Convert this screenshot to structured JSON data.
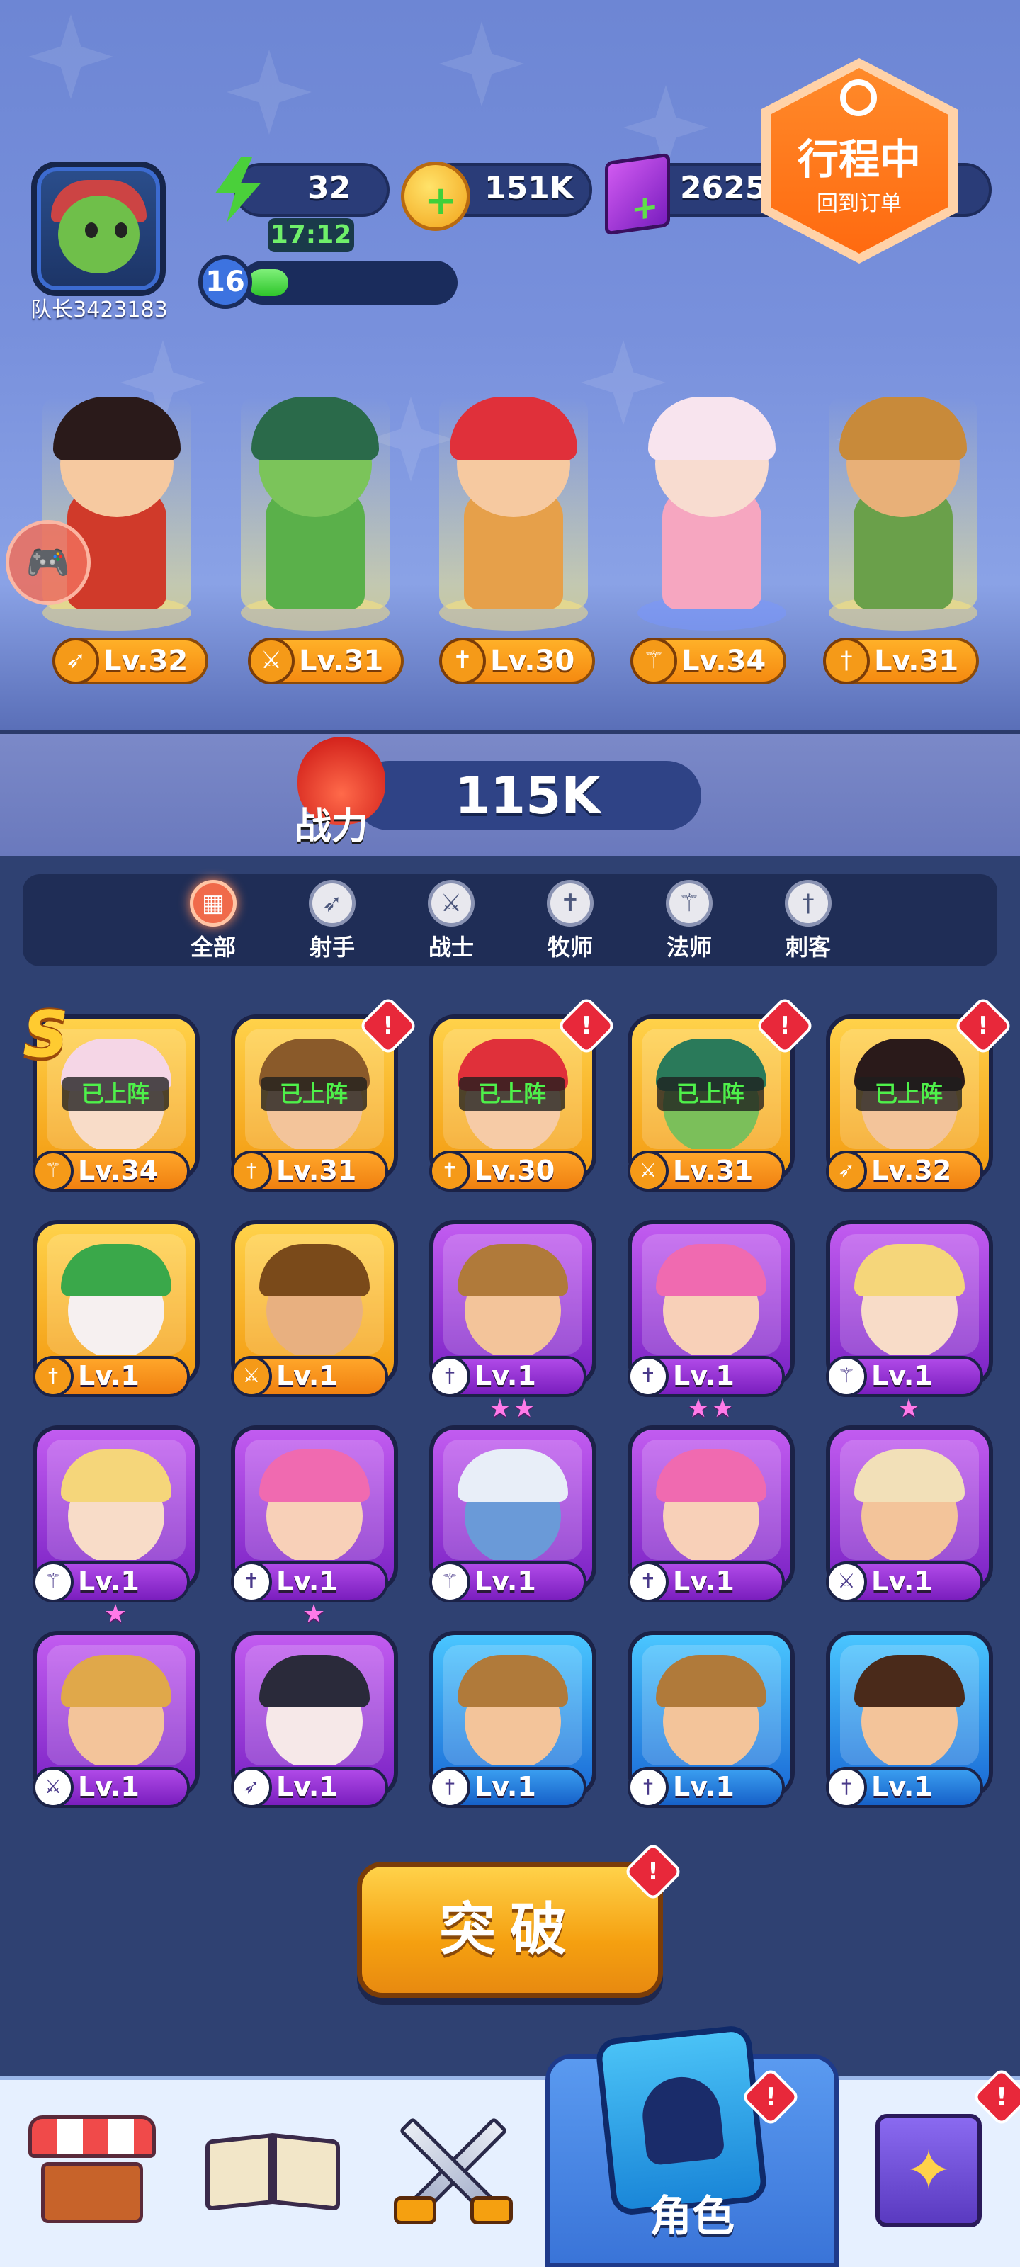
{
  "player": {
    "name": "队长3423183",
    "level": "16",
    "xp_fraction": 0.2
  },
  "resources": {
    "energy": "32",
    "energy_timer": "17:12",
    "gold": "151K",
    "gems": "2625"
  },
  "trip_badge": {
    "title": "行程中",
    "subtitle": "回到订单"
  },
  "lineup": [
    {
      "class_icon": "bow-icon",
      "level": "Lv.32"
    },
    {
      "class_icon": "sword-icon",
      "level": "Lv.31"
    },
    {
      "class_icon": "cross-icon",
      "level": "Lv.30"
    },
    {
      "class_icon": "staff-icon",
      "level": "Lv.34"
    },
    {
      "class_icon": "dagger-icon",
      "level": "Lv.31"
    }
  ],
  "power": {
    "label": "战力",
    "value": "115K"
  },
  "tabs": [
    {
      "label": "全部",
      "active": true
    },
    {
      "label": "射手"
    },
    {
      "label": "战士"
    },
    {
      "label": "牧师"
    },
    {
      "label": "法师"
    },
    {
      "label": "刺客"
    }
  ],
  "deployed_label": "已上阵",
  "rank_badge": "S",
  "heroes": [
    {
      "level": "Lv.34",
      "rarity": "gold",
      "deployed": true,
      "alert": false,
      "stars": 0,
      "class_icon": "staff-icon",
      "hair": "#f5d6e6",
      "skin": "#f8dcc8"
    },
    {
      "level": "Lv.31",
      "rarity": "gold",
      "deployed": true,
      "alert": true,
      "stars": 0,
      "class_icon": "dagger-icon",
      "hair": "#8a5a2a",
      "skin": "#f3c49a"
    },
    {
      "level": "Lv.30",
      "rarity": "gold",
      "deployed": true,
      "alert": true,
      "stars": 0,
      "class_icon": "cross-icon",
      "hair": "#e0303a",
      "skin": "#f6cba6"
    },
    {
      "level": "Lv.31",
      "rarity": "gold",
      "deployed": true,
      "alert": true,
      "stars": 0,
      "class_icon": "sword-icon",
      "hair": "#2a7a5a",
      "skin": "#7bbf5a"
    },
    {
      "level": "Lv.32",
      "rarity": "gold",
      "deployed": true,
      "alert": true,
      "stars": 0,
      "class_icon": "bow-icon",
      "hair": "#2a1a1a",
      "skin": "#f3c49a"
    },
    {
      "level": "Lv.1",
      "rarity": "gold",
      "deployed": false,
      "alert": false,
      "stars": 0,
      "class_icon": "dagger-icon",
      "hair": "#3aa84a",
      "skin": "#f6f0f0"
    },
    {
      "level": "Lv.1",
      "rarity": "gold",
      "deployed": false,
      "alert": false,
      "stars": 0,
      "class_icon": "sword-icon",
      "hair": "#7a4a1a",
      "skin": "#e8b080"
    },
    {
      "level": "Lv.1",
      "rarity": "purple",
      "deployed": false,
      "alert": false,
      "stars": 2,
      "class_icon": "dagger-icon",
      "hair": "#b07a3a",
      "skin": "#f3c49a"
    },
    {
      "level": "Lv.1",
      "rarity": "purple",
      "deployed": false,
      "alert": false,
      "stars": 2,
      "class_icon": "cross-icon",
      "hair": "#f06ab0",
      "skin": "#f8d0b8"
    },
    {
      "level": "Lv.1",
      "rarity": "purple",
      "deployed": false,
      "alert": false,
      "stars": 1,
      "class_icon": "staff-icon",
      "hair": "#f5d67a",
      "skin": "#f8dcc8"
    },
    {
      "level": "Lv.1",
      "rarity": "purple",
      "deployed": false,
      "alert": false,
      "stars": 1,
      "class_icon": "staff-icon",
      "hair": "#f5d67a",
      "skin": "#f8dcc8"
    },
    {
      "level": "Lv.1",
      "rarity": "purple",
      "deployed": false,
      "alert": false,
      "stars": 1,
      "class_icon": "cross-icon",
      "hair": "#f06ab0",
      "skin": "#f8d0b8"
    },
    {
      "level": "Lv.1",
      "rarity": "purple",
      "deployed": false,
      "alert": false,
      "stars": 0,
      "class_icon": "staff-icon",
      "hair": "#e8eef8",
      "skin": "#6a9ad8"
    },
    {
      "level": "Lv.1",
      "rarity": "purple",
      "deployed": false,
      "alert": false,
      "stars": 0,
      "class_icon": "cross-icon",
      "hair": "#f06ab0",
      "skin": "#f8d0b8"
    },
    {
      "level": "Lv.1",
      "rarity": "purple",
      "deployed": false,
      "alert": false,
      "stars": 0,
      "class_icon": "sword-icon",
      "hair": "#f2e0b8",
      "skin": "#f3c49a"
    },
    {
      "level": "Lv.1",
      "rarity": "purple",
      "deployed": false,
      "alert": false,
      "stars": 0,
      "class_icon": "sword-icon",
      "hair": "#e0a84a",
      "skin": "#f3c49a"
    },
    {
      "level": "Lv.1",
      "rarity": "purple",
      "deployed": false,
      "alert": false,
      "stars": 0,
      "class_icon": "bow-icon",
      "hair": "#2a2a3a",
      "skin": "#f6e8e8"
    },
    {
      "level": "Lv.1",
      "rarity": "blue",
      "deployed": false,
      "alert": false,
      "stars": 0,
      "class_icon": "dagger-icon",
      "hair": "#b07a3a",
      "skin": "#f3c49a"
    },
    {
      "level": "Lv.1",
      "rarity": "blue",
      "deployed": false,
      "alert": false,
      "stars": 0,
      "class_icon": "dagger-icon",
      "hair": "#b07a3a",
      "skin": "#f3c49a"
    },
    {
      "level": "Lv.1",
      "rarity": "blue",
      "deployed": false,
      "alert": false,
      "stars": 0,
      "class_icon": "dagger-icon",
      "hair": "#4a2a1a",
      "skin": "#f3c49a"
    }
  ],
  "breakthrough_button": {
    "label": "突破",
    "alert": true
  },
  "bottom_nav": {
    "items": [
      {
        "icon": "shop-icon"
      },
      {
        "icon": "book-icon"
      },
      {
        "icon": "battle-icon"
      },
      {
        "icon": "hero-card-icon",
        "label": "角色",
        "active": true,
        "alert": true
      },
      {
        "icon": "spellbook-icon",
        "alert": true
      }
    ]
  },
  "colors": {
    "gold": "#f5a010",
    "purple": "#9a3ad8",
    "blue": "#2a86e6",
    "alert": "#e8283a",
    "accent": "#ff7a1a"
  }
}
